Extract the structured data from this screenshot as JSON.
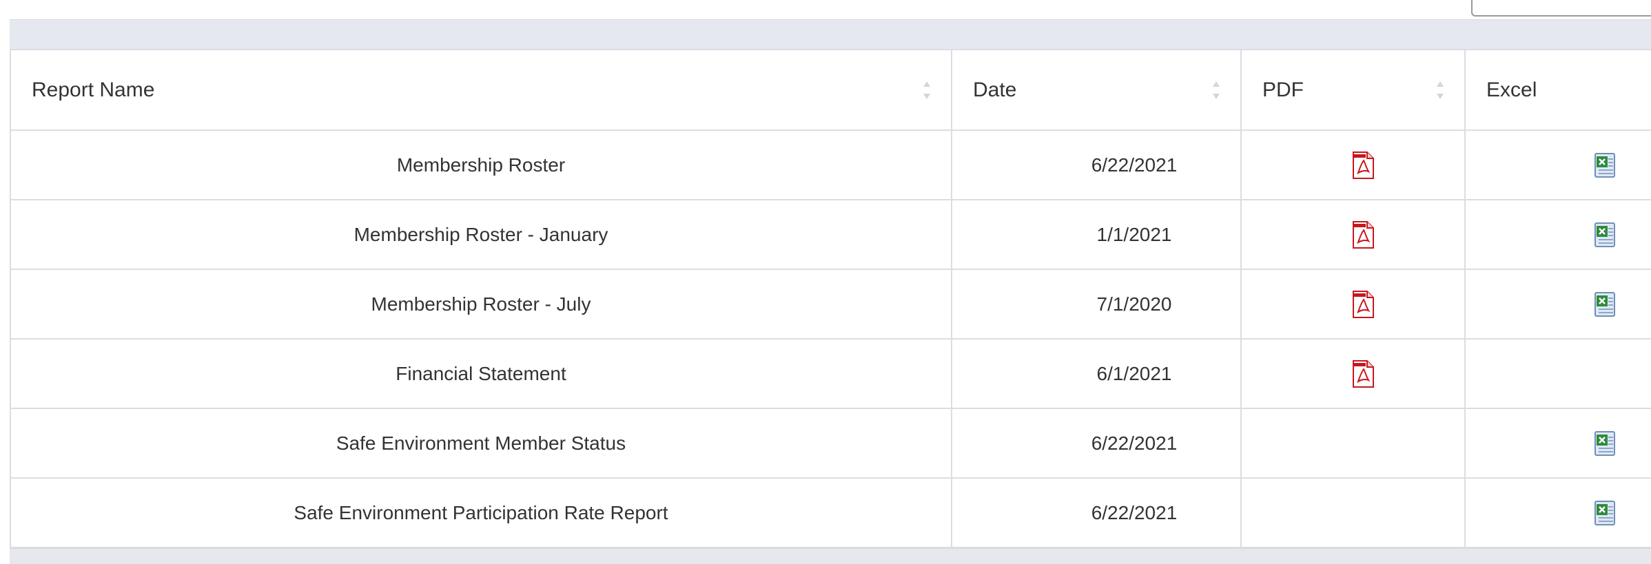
{
  "table": {
    "columns": [
      {
        "label": "Report Name"
      },
      {
        "label": "Date"
      },
      {
        "label": "PDF"
      },
      {
        "label": "Excel"
      }
    ],
    "rows": [
      {
        "name": "Membership Roster",
        "date": "6/22/2021",
        "pdf": true,
        "excel": true
      },
      {
        "name": "Membership Roster - January",
        "date": "1/1/2021",
        "pdf": true,
        "excel": true
      },
      {
        "name": "Membership Roster - July",
        "date": "7/1/2020",
        "pdf": true,
        "excel": true
      },
      {
        "name": "Financial Statement",
        "date": "6/1/2021",
        "pdf": true,
        "excel": false
      },
      {
        "name": "Safe Environment Member Status",
        "date": "6/22/2021",
        "pdf": false,
        "excel": true
      },
      {
        "name": "Safe Environment Participation Rate Report",
        "date": "6/22/2021",
        "pdf": false,
        "excel": true
      }
    ]
  },
  "icons": {
    "pdf": "pdf-file-icon",
    "excel": "excel-file-icon",
    "sort": "sort-arrows-icon"
  },
  "colors": {
    "pdf_red": "#c8161d",
    "excel_green": "#2e8b3d",
    "header_band": "#e6e8ef",
    "border": "#dadde2"
  }
}
